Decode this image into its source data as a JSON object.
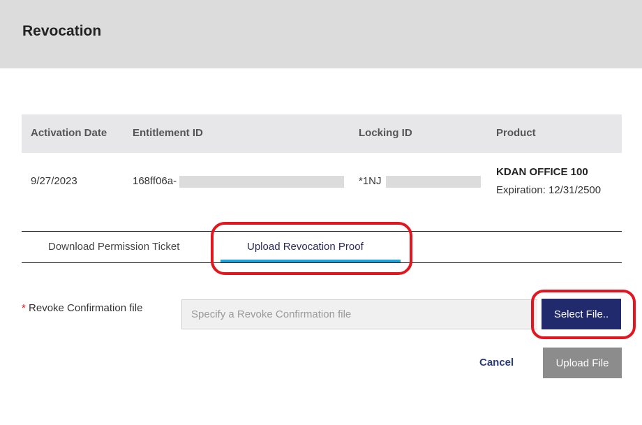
{
  "header": {
    "title": "Revocation"
  },
  "table": {
    "columns": [
      "Activation Date",
      "Entitlement ID",
      "Locking ID",
      "Product"
    ],
    "row": {
      "activation_date": "9/27/2023",
      "entitlement_id": "168ff06a-",
      "locking_id": "*1NJ",
      "product_name": "KDAN OFFICE 100",
      "expiration": "Expiration: 12/31/2500"
    }
  },
  "tabs": [
    {
      "label": "Download Permission Ticket",
      "active": false
    },
    {
      "label": "Upload Revocation Proof",
      "active": true
    }
  ],
  "form": {
    "required_marker": "*",
    "label": "Revoke Confirmation file",
    "placeholder": "Specify a Revoke Confirmation file",
    "select_label": "Select File.."
  },
  "actions": {
    "cancel_label": "Cancel",
    "upload_label": "Upload File"
  },
  "colors": {
    "accent": "#1fa3d6",
    "primary_button": "#222a6e",
    "disabled_button": "#8c8c8c",
    "highlight": "#e3161f"
  }
}
